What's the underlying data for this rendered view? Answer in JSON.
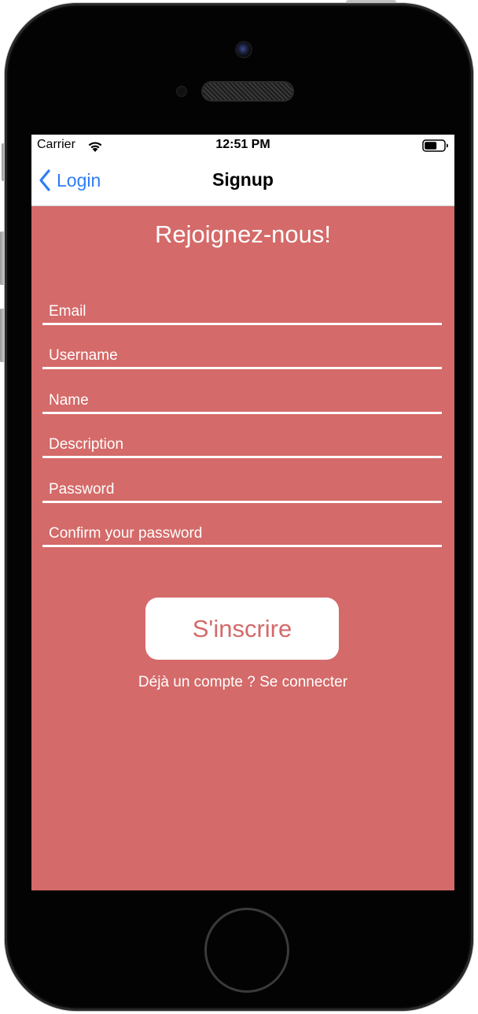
{
  "status_bar": {
    "carrier": "Carrier",
    "time": "12:51 PM",
    "wifi_icon": "wifi-icon",
    "battery_icon": "battery-icon"
  },
  "nav_bar": {
    "back_label": "Login",
    "back_icon": "chevron-left-icon",
    "title": "Signup"
  },
  "form": {
    "heading": "Rejoignez-nous!",
    "fields": [
      {
        "placeholder": "Email",
        "value": ""
      },
      {
        "placeholder": "Username",
        "value": ""
      },
      {
        "placeholder": "Name",
        "value": ""
      },
      {
        "placeholder": "Description",
        "value": ""
      },
      {
        "placeholder": "Password",
        "value": ""
      },
      {
        "placeholder": "Confirm your password",
        "value": ""
      }
    ],
    "submit_label": "S'inscrire",
    "login_link": "Déjà un compte ? Se connecter"
  },
  "colors": {
    "background": "#d46a69",
    "accent": "#2f7cf6",
    "text_on_background": "#ffffff"
  }
}
